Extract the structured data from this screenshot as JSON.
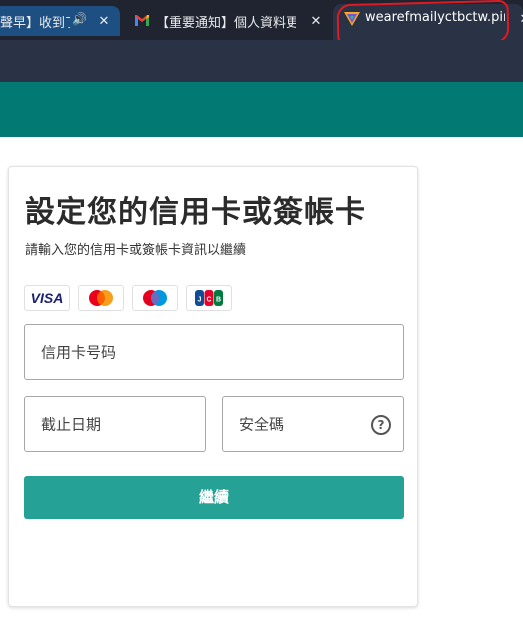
{
  "browser": {
    "tabs": [
      {
        "title": "聲早】收到了",
        "active": false
      },
      {
        "title": "【重要通知】個人資料更",
        "active": false
      },
      {
        "title": "wearefmailyctbctw.pir.c",
        "active": true
      }
    ],
    "close_glyph": "✕",
    "audio_glyph": "🔊"
  },
  "form": {
    "heading": "設定您的信用卡或簽帳卡",
    "subheading": "請輸入您的信用卡或簽帳卡資訊以繼續",
    "card_brands": [
      "VISA",
      "mastercard",
      "maestro",
      "JCB"
    ],
    "card_number_placeholder": "信用卡号码",
    "expiry_placeholder": "截止日期",
    "cvv_placeholder": "安全碼",
    "help_glyph": "?",
    "submit_label": "繼續"
  },
  "colors": {
    "header_teal": "#027a73",
    "button_teal": "#26a196",
    "annotation_red": "#e01a22"
  }
}
